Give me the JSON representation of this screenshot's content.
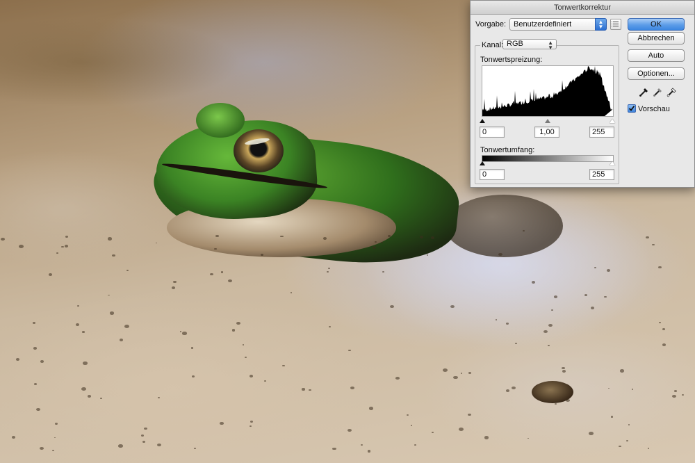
{
  "dialog": {
    "title": "Tonwertkorrektur",
    "preset": {
      "label": "Vorgabe:",
      "value": "Benutzerdefiniert"
    },
    "channel": {
      "label": "Kanal:",
      "value": "RGB"
    },
    "input_levels": {
      "label": "Tonwertspreizung:",
      "black": "0",
      "gamma": "1,00",
      "white": "255"
    },
    "output_levels": {
      "label": "Tonwertumfang:",
      "black": "0",
      "white": "255"
    },
    "buttons": {
      "ok": "OK",
      "cancel": "Abbrechen",
      "auto": "Auto",
      "options": "Optionen..."
    },
    "preview": {
      "label": "Vorschau",
      "checked": true
    },
    "eyedroppers": [
      "black-point-eyedropper-icon",
      "gray-point-eyedropper-icon",
      "white-point-eyedropper-icon"
    ],
    "colors": {
      "primary_button": "#5d9de8",
      "histogram": "#000000"
    }
  }
}
